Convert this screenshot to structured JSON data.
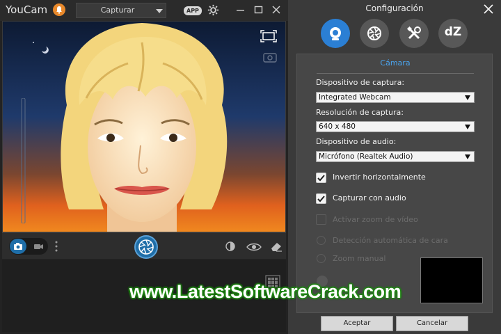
{
  "app": {
    "title": "YouCam",
    "mode_select": "Capturar",
    "app_badge": "APP",
    "icons": [
      "notification-icon",
      "gear-icon",
      "minimize-icon",
      "maximize-icon",
      "close-icon",
      "fullscreen-icon",
      "camera-switch-icon",
      "photo-mode-icon",
      "video-mode-icon",
      "more-icon",
      "shutter-icon",
      "face-tool-icon",
      "eye-icon",
      "eraser-icon",
      "grid-icon"
    ]
  },
  "dialog": {
    "title": "Configuración",
    "tabs": [
      {
        "name": "camera-tab",
        "icon": "webcam-icon",
        "active": true
      },
      {
        "name": "effects-tab",
        "icon": "aperture-icon",
        "active": false
      },
      {
        "name": "tools-tab",
        "icon": "tools-icon",
        "active": false
      },
      {
        "name": "dz-tab",
        "label": "dZ",
        "active": false
      }
    ],
    "section_title": "Cámara",
    "fields": {
      "capture_device_label": "Dispositivo de captura:",
      "capture_device_value": "Integrated Webcam",
      "capture_resolution_label": "Resolución de captura:",
      "capture_resolution_value": "640 x 480",
      "audio_device_label": "Dispositivo de audio:",
      "audio_device_value": "Micrófono (Realtek Audio)"
    },
    "options": {
      "flip_label": "Invertir horizontalmente",
      "flip_checked": true,
      "audio_label": "Capturar con audio",
      "audio_checked": true,
      "video_zoom_label": "Activar zoom de vídeo",
      "video_zoom_checked": false,
      "face_detect_label": "Detección automática de cara",
      "manual_zoom_label": "Zoom manual"
    },
    "ok_label": "Aceptar",
    "cancel_label": "Cancelar"
  },
  "watermark": "www.LatestSoftwareCrack.com",
  "colors": {
    "accent": "#2b7fd4",
    "notification": "#e9892b",
    "link": "#4aa5f0",
    "watermark_glow": "#1f8a12"
  }
}
